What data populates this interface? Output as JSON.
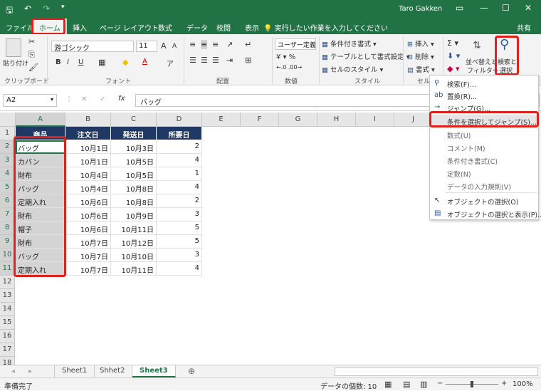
{
  "title_bar": {
    "user": "Taro Gakken"
  },
  "tabs": [
    "ファイル",
    "ホーム",
    "挿入",
    "ページ レイアウト",
    "数式",
    "データ",
    "校閲",
    "表示"
  ],
  "tell_me": "実行したい作業を入力してください",
  "share": "共有",
  "ribbon": {
    "clipboard": {
      "paste": "貼り付け",
      "label": "クリップボード"
    },
    "font": {
      "name": "游ゴシック",
      "size": "11",
      "bold": "B",
      "italic": "I",
      "underline": "U",
      "label": "フォント",
      "grow": "A",
      "shrink": "A",
      "color_a": "A",
      "wrap": "ア"
    },
    "alignment": {
      "label": "配置"
    },
    "number": {
      "format": "ユーザー定義",
      "label": "数値"
    },
    "styles": {
      "conditional": "条件付き書式",
      "table": "テーブルとして書式設定",
      "cell": "セルのスタイル",
      "label": "スタイル"
    },
    "cells": {
      "insert": "挿入",
      "delete": "削除",
      "format": "書式",
      "label": "セル"
    },
    "editing": {
      "sort": "並べ替えと",
      "filter": "フィルター",
      "find": "検索と",
      "select": "選択"
    }
  },
  "formula_bar": {
    "name_box": "A2",
    "value": "バッグ",
    "fx": "fx"
  },
  "columns": [
    "A",
    "B",
    "C",
    "D",
    "E",
    "F",
    "G",
    "H",
    "I",
    "J"
  ],
  "rows": [
    "1",
    "2",
    "3",
    "4",
    "5",
    "6",
    "7",
    "8",
    "9",
    "10",
    "11",
    "12",
    "13",
    "14",
    "15",
    "16",
    "17",
    "18"
  ],
  "table": {
    "headers": [
      "商品",
      "注文日",
      "発送日",
      "所要日"
    ],
    "data": [
      [
        "バッグ",
        "10月1日",
        "10月3日",
        "2"
      ],
      [
        "カバン",
        "10月1日",
        "10月5日",
        "4"
      ],
      [
        "財布",
        "10月4日",
        "10月5日",
        "1"
      ],
      [
        "バッグ",
        "10月4日",
        "10月8日",
        "4"
      ],
      [
        "定期入れ",
        "10月6日",
        "10月8日",
        "2"
      ],
      [
        "財布",
        "10月6日",
        "10月9日",
        "3"
      ],
      [
        "帽子",
        "10月6日",
        "10月11日",
        "5"
      ],
      [
        "財布",
        "10月7日",
        "10月12日",
        "5"
      ],
      [
        "バッグ",
        "10月7日",
        "10月10日",
        "3"
      ],
      [
        "定期入れ",
        "10月7日",
        "10月11日",
        "4"
      ]
    ]
  },
  "dropdown": [
    {
      "label": "検索(F)...",
      "icon": "search-icon"
    },
    {
      "label": "置換(R)...",
      "icon": "replace-icon"
    },
    {
      "label": "ジャンプ(G)...",
      "icon": "arrow-right-icon"
    },
    {
      "label": "条件を選択してジャンプ(S)...",
      "icon": "none"
    },
    {
      "label": "数式(U)",
      "icon": "none"
    },
    {
      "label": "コメント(M)",
      "icon": "none"
    },
    {
      "label": "条件付き書式(C)",
      "icon": "none"
    },
    {
      "label": "定数(N)",
      "icon": "none"
    },
    {
      "label": "データの入力規則(V)",
      "icon": "none"
    },
    {
      "label": "オブジェクトの選択(O)",
      "icon": "cursor-icon"
    },
    {
      "label": "オブジェクトの選択と表示(P)...",
      "icon": "selection-pane-icon"
    }
  ],
  "sheets": [
    "Sheet1",
    "Shhet2",
    "Sheet3"
  ],
  "status": {
    "ready": "準備完了",
    "count": "データの個数: 10",
    "zoom": "100%"
  },
  "colors": {
    "excel_green": "#217346",
    "header_navy": "#203864",
    "highlight_red": "#e0201b"
  }
}
